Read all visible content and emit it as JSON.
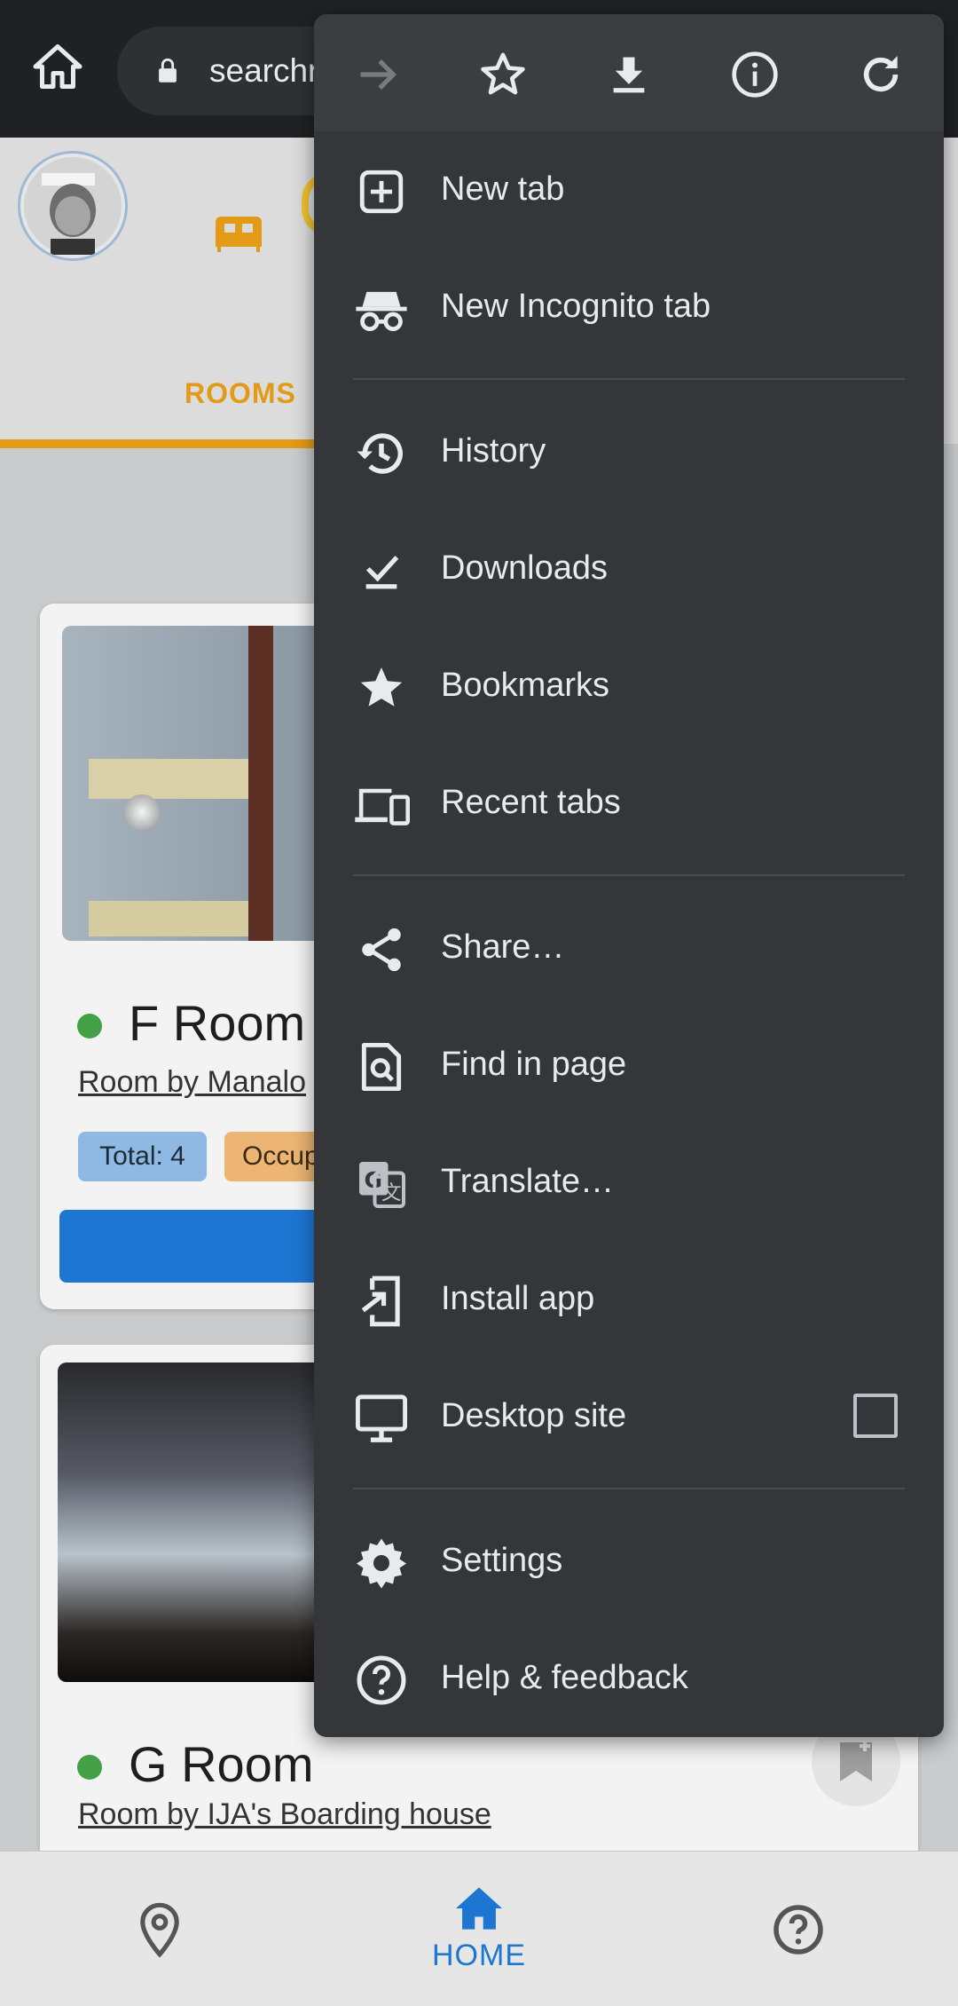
{
  "browser": {
    "url_text": "searchr",
    "toolbar_icons": [
      "forward-icon",
      "bookmark-star-icon",
      "download-icon",
      "info-icon",
      "reload-icon"
    ]
  },
  "menu": {
    "items": [
      {
        "label": "New tab",
        "icon": "new-tab-icon"
      },
      {
        "label": "New Incognito tab",
        "icon": "incognito-icon"
      },
      {
        "label": "History",
        "icon": "history-icon"
      },
      {
        "label": "Downloads",
        "icon": "downloads-icon"
      },
      {
        "label": "Bookmarks",
        "icon": "bookmarks-icon"
      },
      {
        "label": "Recent tabs",
        "icon": "recent-tabs-icon"
      },
      {
        "label": "Share…",
        "icon": "share-icon"
      },
      {
        "label": "Find in page",
        "icon": "find-in-page-icon"
      },
      {
        "label": "Translate…",
        "icon": "translate-icon"
      },
      {
        "label": "Install app",
        "icon": "install-app-icon"
      },
      {
        "label": "Desktop site",
        "icon": "desktop-icon",
        "checked": false
      },
      {
        "label": "Settings",
        "icon": "settings-icon"
      },
      {
        "label": "Help & feedback",
        "icon": "help-icon"
      }
    ]
  },
  "page": {
    "tab_rooms_label": "ROOMS",
    "cards": [
      {
        "title": "F Room",
        "owner_link": "Room by Manalo",
        "total_badge": "Total: 4",
        "occupied_badge": "Occup"
      },
      {
        "title": "G Room",
        "owner_link": "Room by IJA's Boarding house"
      }
    ],
    "colors": {
      "accent": "#e39a16",
      "primary": "#1e76d3",
      "status_available": "#43a047"
    }
  },
  "bottom_nav": {
    "home_label": "HOME"
  }
}
